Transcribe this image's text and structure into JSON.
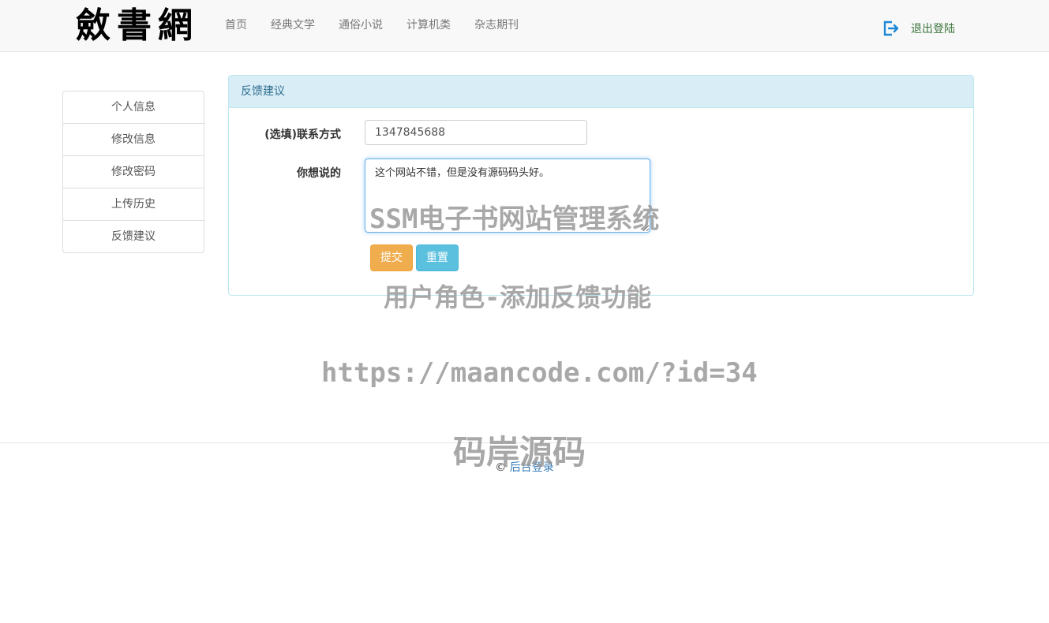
{
  "header": {
    "logo_text": "斂書網",
    "nav": [
      "首页",
      "经典文学",
      "通俗小说",
      "计算机类",
      "杂志期刊"
    ],
    "logout_label": "退出登陆",
    "logout_icon": "logout-icon"
  },
  "sidebar": {
    "items": [
      "个人信息",
      "修改信息",
      "修改密码",
      "上传历史",
      "反馈建议"
    ]
  },
  "panel": {
    "title": "反馈建议",
    "contact_label": "(选填)联系方式",
    "contact_value": "1347845688",
    "message_label": "你想说的",
    "message_value": "这个网站不错，但是没有源码码头好。",
    "submit_label": "提交",
    "reset_label": "重置"
  },
  "watermarks": [
    "SSM电子书网站管理系统",
    "用户角色-添加反馈功能",
    "https://maancode.com/?id=34",
    "码岸源码"
  ],
  "footer": {
    "copyright_symbol": "©",
    "link_label": "后台登录"
  },
  "colors": {
    "panel_heading_bg": "#d9edf7",
    "panel_heading_text": "#31708f",
    "submit_bg": "#f0ad4e",
    "reset_bg": "#5bc0de",
    "logout_icon": "#1e88d8",
    "logout_text": "#3c763d",
    "link": "#337ab7"
  }
}
